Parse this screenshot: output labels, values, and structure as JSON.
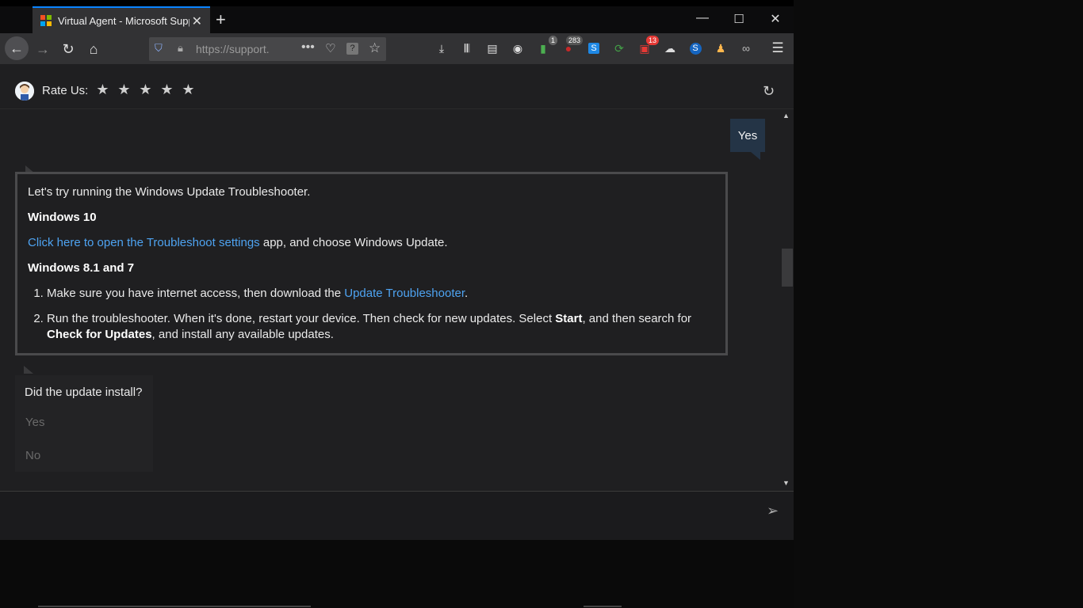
{
  "browser": {
    "tab_title": "Virtual Agent - Microsoft Support",
    "url": "https://support.",
    "badges": {
      "b1": "1",
      "b2": "283",
      "b3": "13"
    }
  },
  "header": {
    "rate_label": "Rate Us:",
    "stars": [
      "★",
      "★",
      "★",
      "★",
      "★"
    ]
  },
  "chat": {
    "user_reply": "Yes",
    "card": {
      "intro": "Let's try running the Windows Update Troubleshooter.",
      "win10_heading": "Windows 10",
      "win10_link": "Click here to open the Troubleshoot settings",
      "win10_rest": " app, and choose Windows Update.",
      "win81_heading": "Windows 8.1 and 7",
      "step1_pre": "Make sure you have internet access, then download the ",
      "step1_link": "Update Troubleshooter",
      "step1_post": ".",
      "step2_a": "Run the troubleshooter. When it's done, restart your device. Then check for new updates. Select ",
      "step2_start": "Start",
      "step2_b": ", and then search for ",
      "step2_check": "Check for Updates",
      "step2_c": ", and install any available updates."
    },
    "question": {
      "text": "Did the update install?",
      "options": [
        "Yes",
        "No"
      ]
    }
  },
  "colors": {
    "accent_link": "#4ea3f1",
    "user_bubble": "#243446",
    "tab_highlight": "#0a84ff"
  }
}
